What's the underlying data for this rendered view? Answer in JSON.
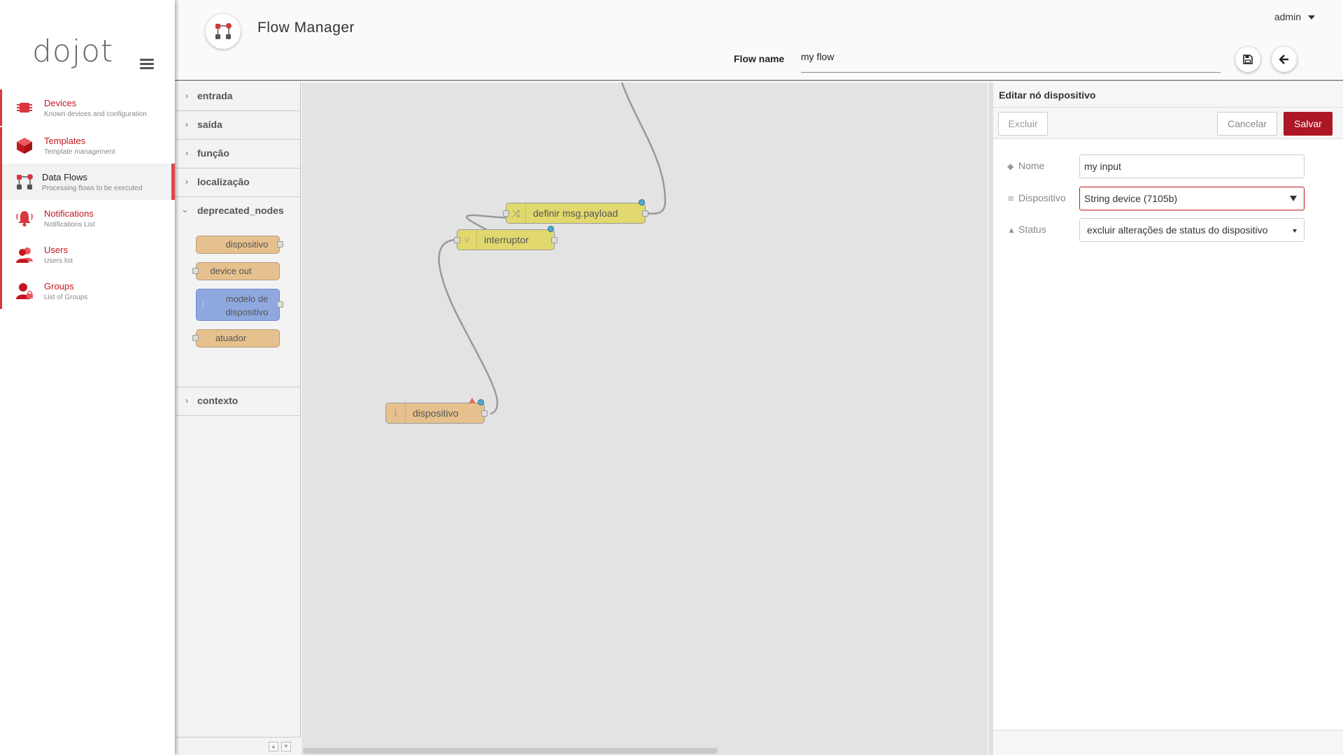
{
  "sidebar": {
    "logo": "dojot",
    "items": [
      {
        "title": "Devices",
        "subtitle": "Known devices and configuration"
      },
      {
        "title": "Templates",
        "subtitle": "Template management"
      },
      {
        "title": "Data Flows",
        "subtitle": "Processing flows to be executed"
      },
      {
        "title": "Notifications",
        "subtitle": "Notifications List"
      },
      {
        "title": "Users",
        "subtitle": "Users list"
      },
      {
        "title": "Groups",
        "subtitle": "List of Groups"
      }
    ],
    "active_item": "Data Flows"
  },
  "header": {
    "title": "Flow Manager",
    "user": "admin",
    "flow_name_label": "Flow name",
    "flow_name_value": "my flow"
  },
  "palette": {
    "categories": {
      "entrada": "entrada",
      "saida": "saída",
      "funcao": "função",
      "localizacao": "localização",
      "deprecated": "deprecated_nodes",
      "contexto": "contexto"
    },
    "deprecated_nodes": [
      {
        "label": "dispositivo"
      },
      {
        "label": "device out"
      },
      {
        "label": "modelo de dispositivo"
      },
      {
        "label": "atuador"
      }
    ]
  },
  "workspace": {
    "nodes": [
      {
        "label": "definir msg.payload",
        "type": "change"
      },
      {
        "label": "interruptor",
        "type": "switch"
      },
      {
        "label": "dispositivo",
        "type": "device-in"
      }
    ]
  },
  "editor": {
    "title": "Editar nó dispositivo",
    "delete_label": "Excluir",
    "cancel_label": "Cancelar",
    "save_label": "Salvar",
    "fields": {
      "nome_label": "Nome",
      "nome_value": "my input",
      "dispositivo_label": "Dispositivo",
      "dispositivo_value": "String device (7105b)",
      "status_label": "Status",
      "status_value": "excluir alterações de status do dispositivo"
    }
  },
  "colors": {
    "brand_red": "#c5161d",
    "save_button": "#ad1625",
    "function_node": "#e2d96e",
    "device_node": "#e6c18e",
    "template_node": "#8fa9e0",
    "workspace_bg": "#e3e3e3"
  }
}
